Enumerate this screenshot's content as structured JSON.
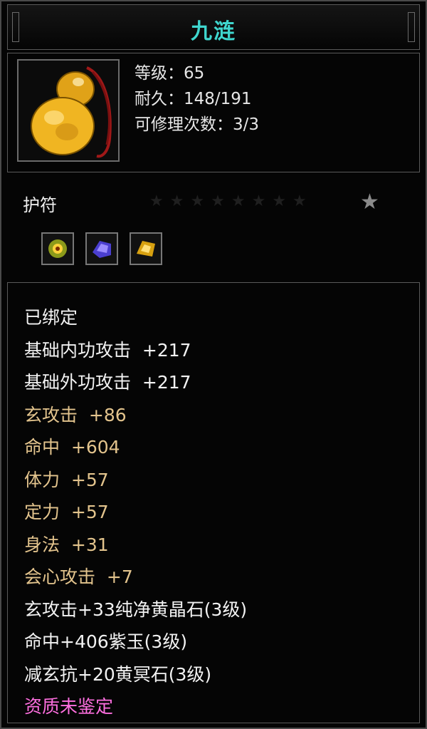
{
  "item": {
    "name": "九涟",
    "icon": "amulet-gourd-icon",
    "stats": {
      "level": "等级：65",
      "durability": "耐久：148/191",
      "repairs": "可修理次数：3/3"
    },
    "type": "护符",
    "star_rating": {
      "filled": 0,
      "total": 9
    },
    "gem_slots": [
      "green-gold-gem-icon",
      "purple-gem-icon",
      "yellow-gem-icon"
    ],
    "attributes": [
      {
        "text": "已绑定",
        "color": "#f2f2f2"
      },
      {
        "text": "基础内功攻击  +217",
        "color": "#f2f2f2"
      },
      {
        "text": "基础外功攻击  +217",
        "color": "#f2f2f2"
      },
      {
        "text": "玄攻击  +86",
        "color": "#e3c48d"
      },
      {
        "text": "命中  +604",
        "color": "#e3c48d"
      },
      {
        "text": "体力  +57",
        "color": "#e3c48d"
      },
      {
        "text": "定力  +57",
        "color": "#e3c48d"
      },
      {
        "text": "身法  +31",
        "color": "#e3c48d"
      },
      {
        "text": "会心攻击  +7",
        "color": "#e3c48d"
      },
      {
        "text": "玄攻击+33纯净黄晶石(3级)",
        "color": "#f2f2f2"
      },
      {
        "text": "命中+406紫玉(3级)",
        "color": "#f2f2f2"
      },
      {
        "text": "减玄抗+20黄冥石(3级)",
        "color": "#f2f2f2"
      },
      {
        "text": "资质未鉴定",
        "color": "#ff6fe0"
      }
    ]
  },
  "colors": {
    "title": "#3fd7cf",
    "accent_gold": "#e3c48d",
    "quality_pink": "#ff6fe0"
  }
}
